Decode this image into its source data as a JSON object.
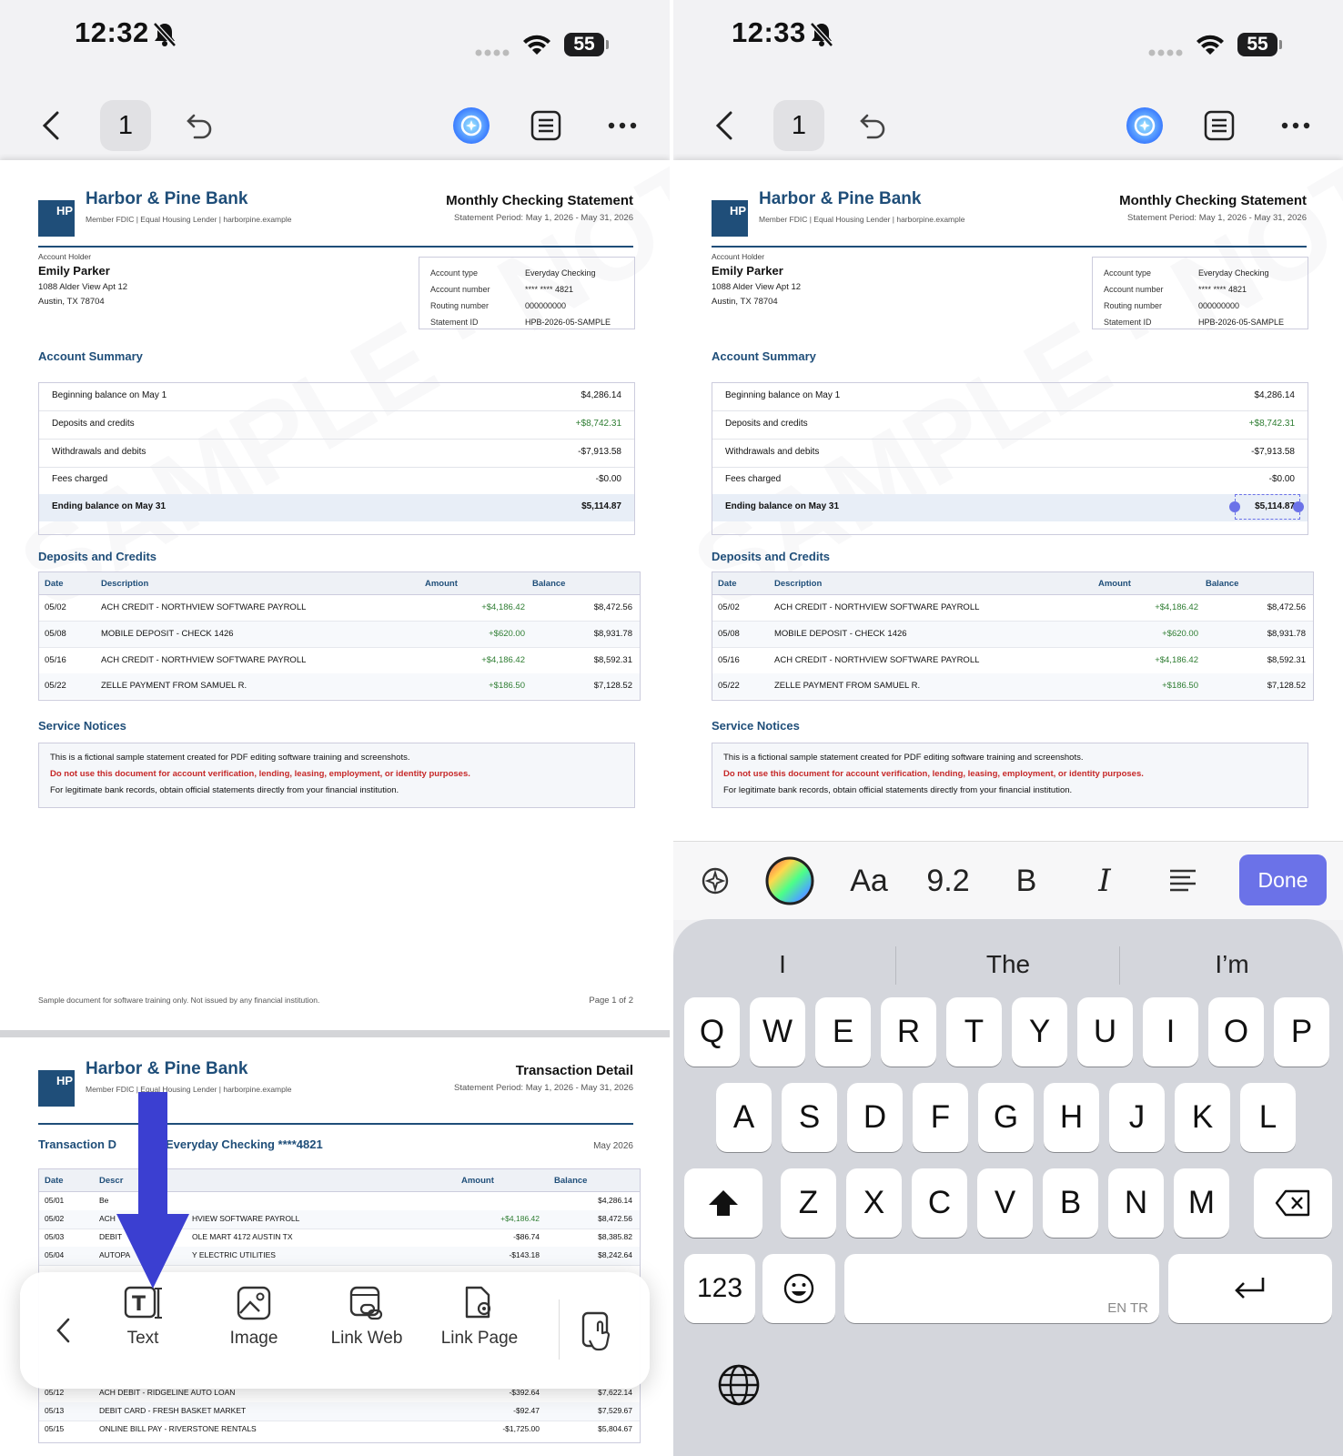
{
  "left_screen": {
    "status": {
      "time": "12:32",
      "battery": "55"
    },
    "toolbar": {
      "page_number": "1"
    }
  },
  "right_screen": {
    "status": {
      "time": "12:33",
      "battery": "55"
    },
    "toolbar": {
      "page_number": "1"
    }
  },
  "document": {
    "logo_text": "HP",
    "bank_name": "Harbor & Pine Bank",
    "tagline": "Member FDIC | Equal Housing Lender | harborpine.example",
    "title": "Monthly Checking Statement",
    "period": "Statement Period: May 1, 2026 - May 31, 2026",
    "account_holder_label": "Account Holder",
    "holder_name": "Emily Parker",
    "address_line1": "1088 Alder View Apt 12",
    "address_line2": "Austin, TX 78704",
    "account_info": [
      {
        "label": "Account type",
        "value": "Everyday Checking"
      },
      {
        "label": "Account number",
        "value": "**** **** 4821"
      },
      {
        "label": "Routing number",
        "value": "000000000"
      },
      {
        "label": "Statement ID",
        "value": "HPB-2026-05-SAMPLE"
      }
    ],
    "summary_title": "Account Summary",
    "summary": [
      {
        "label": "Beginning balance on May 1",
        "value": "$4,286.14"
      },
      {
        "label": "Deposits and credits",
        "value": "+$8,742.31"
      },
      {
        "label": "Withdrawals and debits",
        "value": "-$7,913.58"
      },
      {
        "label": "Fees charged",
        "value": "-$0.00"
      },
      {
        "label": "Ending balance on May 31",
        "value": "$5,114.87"
      }
    ],
    "deposits_title": "Deposits and Credits",
    "deposits_headers": {
      "date": "Date",
      "description": "Description",
      "amount": "Amount",
      "balance": "Balance"
    },
    "deposits": [
      {
        "date": "05/02",
        "description": "ACH CREDIT - NORTHVIEW SOFTWARE PAYROLL",
        "amount": "+$4,186.42",
        "balance": "$8,472.56"
      },
      {
        "date": "05/08",
        "description": "MOBILE DEPOSIT - CHECK 1426",
        "amount": "+$620.00",
        "balance": "$8,931.78"
      },
      {
        "date": "05/16",
        "description": "ACH CREDIT - NORTHVIEW SOFTWARE PAYROLL",
        "amount": "+$4,186.42",
        "balance": "$8,592.31"
      },
      {
        "date": "05/22",
        "description": "ZELLE PAYMENT FROM SAMUEL R.",
        "amount": "+$186.50",
        "balance": "$7,128.52"
      }
    ],
    "notices_title": "Service Notices",
    "notice_line1": "This is a fictional sample statement created for PDF editing software training and screenshots.",
    "notice_line2": "Do not use this document for account verification, lending, leasing, employment, or identity purposes.",
    "notice_line3": "For legitimate bank records, obtain official statements directly from your financial institution.",
    "footer": "Sample document for software training only. Not issued by any financial institution.",
    "page_label": "Page 1 of 2"
  },
  "page2": {
    "title": "Transaction Detail",
    "section_left": "Transaction D",
    "section_right": "Everyday Checking ****4821",
    "month": "May 2026",
    "headers": {
      "date": "Date",
      "description": "Descr",
      "amount": "Amount",
      "balance": "Balance"
    },
    "rows_top": [
      {
        "date": "05/01",
        "description": "Be",
        "amount": "",
        "balance": "$4,286.14"
      },
      {
        "date": "05/02",
        "description": "ACH",
        "desc2": "HVIEW SOFTWARE PAYROLL",
        "amount": "+$4,186.42",
        "balance": "$8,472.56"
      },
      {
        "date": "05/03",
        "description": "DEBIT",
        "desc2": "OLE MART 4172 AUSTIN TX",
        "amount": "-$86.74",
        "balance": "$8,385.82"
      },
      {
        "date": "05/04",
        "description": "AUTOPA",
        "desc2": "Y ELECTRIC UTILITIES",
        "amount": "-$143.18",
        "balance": "$8,242.64"
      }
    ],
    "rows_bottom": [
      {
        "date": "05/12",
        "description": "ACH DEBIT - RIDGELINE AUTO LOAN",
        "amount": "-$392.64",
        "balance": "$7,622.14"
      },
      {
        "date": "05/13",
        "description": "DEBIT CARD - FRESH BASKET MARKET",
        "amount": "-$92.47",
        "balance": "$7,529.67"
      },
      {
        "date": "05/15",
        "description": "ONLINE BILL PAY - RIVERSTONE RENTALS",
        "amount": "-$1,725.00",
        "balance": "$5,804.67"
      }
    ]
  },
  "action_bar": {
    "items": [
      "Text",
      "Image",
      "Link Web",
      "Link Page"
    ]
  },
  "format_bar": {
    "font_label": "Aa",
    "font_size": "9.2",
    "bold": "B",
    "italic": "I",
    "done": "Done"
  },
  "keyboard": {
    "suggestions": [
      "I",
      "The",
      "I’m"
    ],
    "row1": [
      "Q",
      "W",
      "E",
      "R",
      "T",
      "Y",
      "U",
      "I",
      "O",
      "P"
    ],
    "row2": [
      "A",
      "S",
      "D",
      "F",
      "G",
      "H",
      "J",
      "K",
      "L"
    ],
    "row3": [
      "Z",
      "X",
      "C",
      "V",
      "B",
      "N",
      "M"
    ],
    "numbers_key": "123",
    "space_lang": "EN TR"
  },
  "colors": {
    "accent": "#6b72e8",
    "brand": "#1f4e79",
    "arrow": "#3b3fd1"
  }
}
